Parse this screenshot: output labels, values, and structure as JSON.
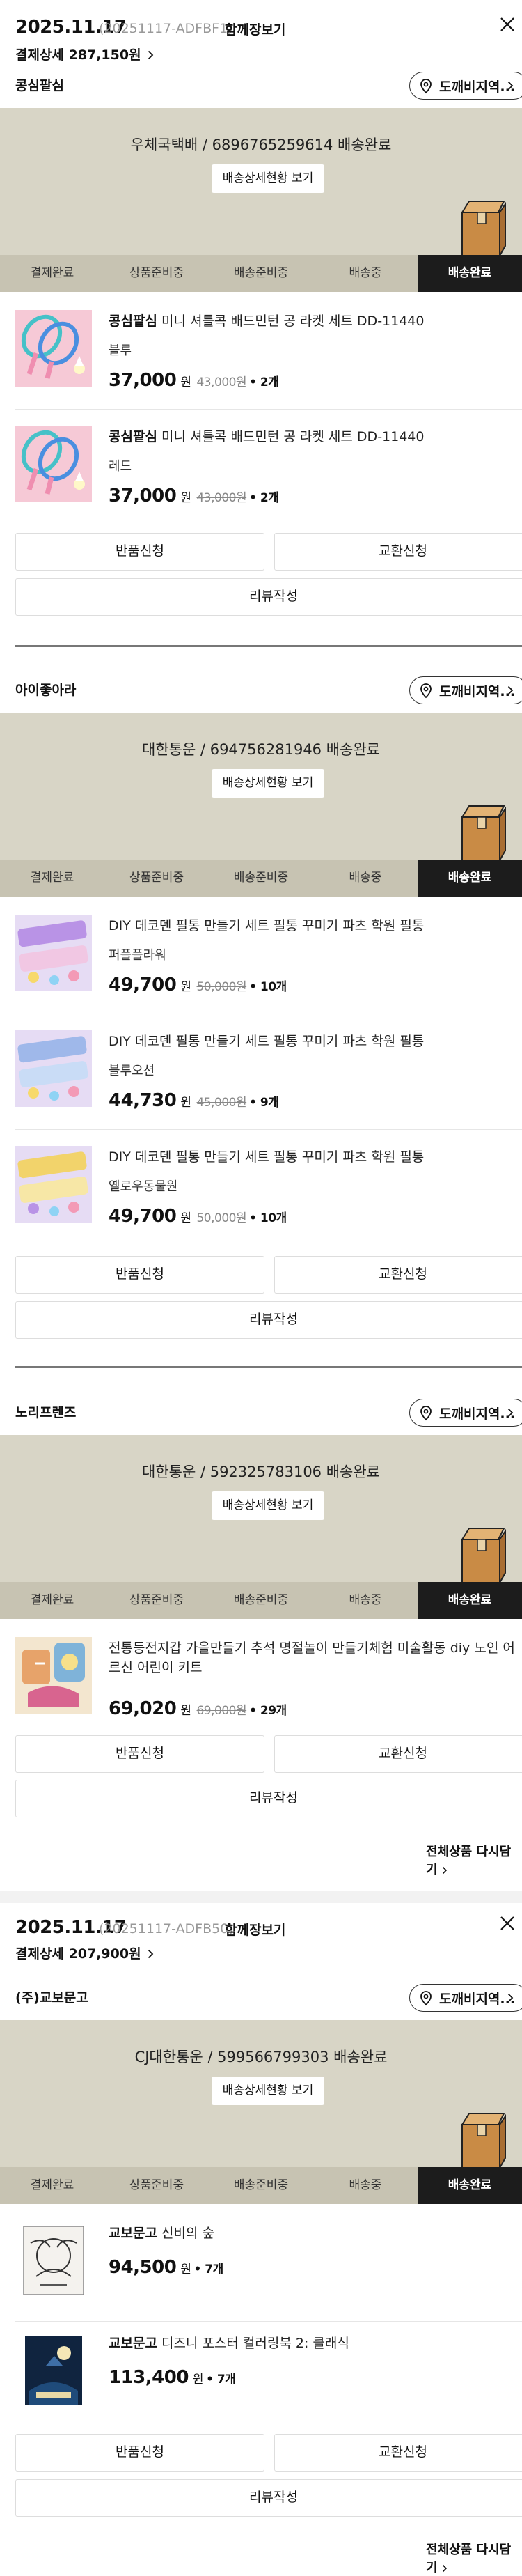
{
  "orders": [
    {
      "date": "2025.11.17",
      "order_no": "(20251117-ADFBF1)",
      "toggle_label": "함께장보기",
      "summary_label": "결제상세",
      "summary_amount": "287,150원",
      "reorder_label": "전체상품 다시담기",
      "shops": [
        {
          "name": "콩심팥심",
          "visit_label": "도깨비지역...",
          "carrier": "우체국택배 / 6896765259614 배송완료",
          "track_label": "배송상세현황 보기",
          "items": [
            {
              "brand": "콩심팥심",
              "title": "미니 셔틀콕 배드민턴 공 라켓 세트 DD-11440",
              "option": "블루",
              "price": "37,000",
              "won": "원",
              "orig_price": "43,000원",
              "qty": "• 2개"
            },
            {
              "brand": "콩심팥심",
              "title": "미니 셔틀콕 배드민턴 공 라켓 세트 DD-11440",
              "option": "레드",
              "price": "37,000",
              "won": "원",
              "orig_price": "43,000원",
              "qty": "• 2개"
            }
          ]
        },
        {
          "name": "아이좋아라",
          "visit_label": "도깨비지역...",
          "carrier": "대한통운 / 694756281946 배송완료",
          "track_label": "배송상세현황 보기",
          "items": [
            {
              "brand": "",
              "title": "DIY 데코덴 필통 만들기 세트 필통 꾸미기 파츠 학원 필통",
              "option": "퍼플플라워",
              "price": "49,700",
              "won": "원",
              "orig_price": "50,000원",
              "qty": "• 10개"
            },
            {
              "brand": "",
              "title": "DIY 데코덴 필통 만들기 세트 필통 꾸미기 파츠 학원 필통",
              "option": "블루오션",
              "price": "44,730",
              "won": "원",
              "orig_price": "45,000원",
              "qty": "• 9개"
            },
            {
              "brand": "",
              "title": "DIY 데코덴 필통 만들기 세트 필통 꾸미기 파츠 학원 필통",
              "option": "옐로우동물원",
              "price": "49,700",
              "won": "원",
              "orig_price": "50,000원",
              "qty": "• 10개"
            }
          ]
        },
        {
          "name": "노리프렌즈",
          "visit_label": "도깨비지역...",
          "carrier": "대한통운 / 592325783106 배송완료",
          "track_label": "배송상세현황 보기",
          "items": [
            {
              "brand": "",
              "title": "전통등전지갑 가을만들기 추석 명절놀이 만들기체험 미술활동 diy 노인 어르신 어린이 키트",
              "option": "",
              "price": "69,020",
              "won": "원",
              "orig_price": "69,000원",
              "qty": "• 29개"
            }
          ]
        }
      ]
    },
    {
      "date": "2025.11.17",
      "order_no": "(20251117-ADFB50)",
      "toggle_label": "함께장보기",
      "summary_label": "결제상세",
      "summary_amount": "207,900원",
      "reorder_label": "전체상품 다시담기",
      "shops": [
        {
          "name": "(주)교보문고",
          "visit_label": "도깨비지역...",
          "carrier": "CJ대한통운 / 599566799303 배송완료",
          "track_label": "배송상세현황 보기",
          "items": [
            {
              "brand": "교보문고",
              "title": "신비의 숲",
              "option": "",
              "price": "94,500",
              "won": "원",
              "orig_price": "",
              "qty": "• 7개"
            },
            {
              "brand": "교보문고",
              "title": "디즈니 포스터 컬러링북 2: 클래식",
              "option": "",
              "price": "113,400",
              "won": "원",
              "orig_price": "",
              "qty": "• 7개"
            }
          ]
        }
      ]
    }
  ],
  "steps": [
    "결제완료",
    "상품준비중",
    "배송준비중",
    "배송중",
    "배송완료"
  ],
  "actions": {
    "return_label": "반품신청",
    "exchange_label": "교환신청",
    "review_label": "리뷰작성"
  },
  "icons": {
    "close": "close-icon",
    "location": "location-pin-icon",
    "chevron": "chevron-right-icon",
    "box": "parcel-box-icon"
  },
  "colors": {
    "tracker_bg": "#d8d5c6",
    "steps_bg": "#c7c3b2",
    "active_step": "#1c1c1c"
  }
}
